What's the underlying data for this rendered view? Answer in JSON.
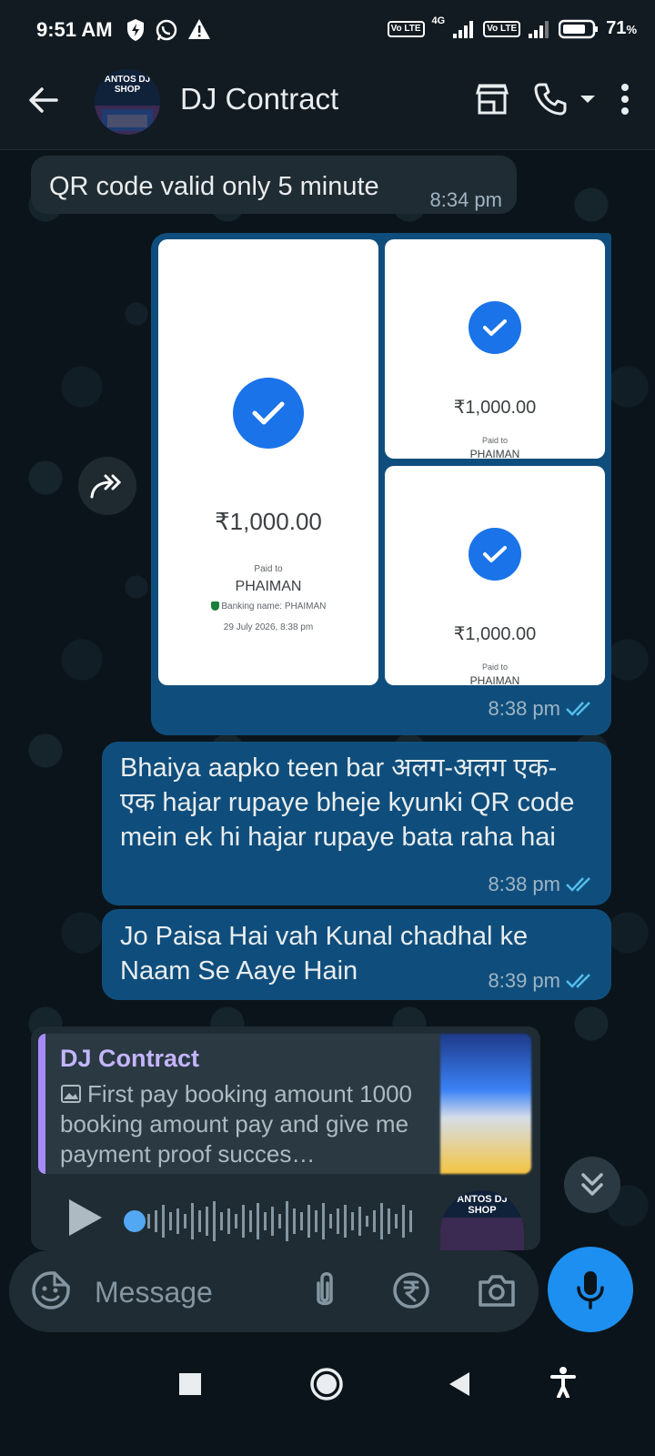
{
  "status": {
    "time": "9:51 AM",
    "net1": "Vo LTE",
    "net_4g": "4G",
    "net2": "Vo LTE",
    "battery": "71"
  },
  "header": {
    "title": "DJ Contract",
    "avatar_text": "ANTOS DJ SHOP"
  },
  "messages": {
    "m1": {
      "text": "QR code valid only 5 minute",
      "time": "8:34 pm"
    },
    "images": {
      "time": "8:38 pm",
      "receipts": [
        {
          "amount": "₹1,000.00",
          "paid_to": "Paid to",
          "payee": "PHAIMAN",
          "banking": "Banking name: PHAIMAN",
          "date": "29 July 2026, 8:38 pm"
        },
        {
          "amount": "₹1,000.00",
          "paid_to": "Paid to",
          "payee": "PHAIMAN"
        },
        {
          "amount": "₹1,000.00",
          "paid_to": "Paid to",
          "payee": "PHAIMAN"
        }
      ]
    },
    "m2": {
      "text": "Bhaiya aapko teen bar अलग-अलग एक-एक hajar rupaye bheje kyunki QR code mein ek hi hajar rupaye bata raha hai",
      "time": "8:38 pm"
    },
    "m3": {
      "text": "Jo Paisa Hai vah Kunal chadhal ke Naam Se Aaye Hain",
      "time": "8:39 pm"
    },
    "reply": {
      "name": "DJ Contract",
      "text": "First pay booking amount 1000 booking amount pay and give me payment proof succes…"
    }
  },
  "composer": {
    "placeholder": "Message"
  },
  "colors": {
    "outgoing": "#0f4e7c",
    "incoming": "#202c33",
    "accent": "#1d8ff0",
    "read_ticks": "#53bdeb"
  }
}
